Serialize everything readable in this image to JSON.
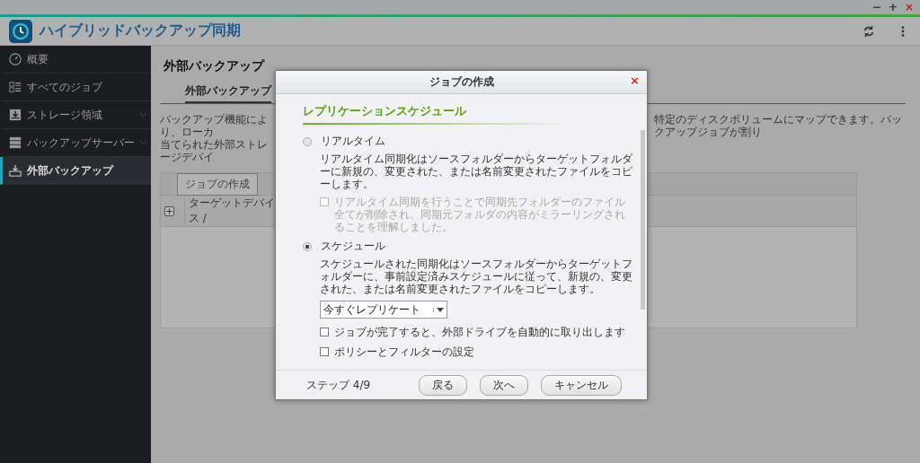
{
  "window_controls": [
    "−",
    "+",
    "×"
  ],
  "app": {
    "title": "ハイブリッドバックアップ同期"
  },
  "sidebar": {
    "items": [
      {
        "label": "概要",
        "expandable": false,
        "selected": false
      },
      {
        "label": "すべてのジョブ",
        "expandable": false,
        "selected": false
      },
      {
        "label": "ストレージ領域",
        "expandable": true,
        "selected": false
      },
      {
        "label": "バックアップサーバー",
        "expandable": true,
        "selected": false
      },
      {
        "label": "外部バックアップ",
        "expandable": false,
        "selected": true
      }
    ]
  },
  "main": {
    "title": "外部バックアップ",
    "tabs": [
      {
        "label": "外部バックアップ",
        "selected": true
      }
    ],
    "description_left": [
      "バックアップ機能により、ローカ",
      "当てられた外部ストレージデバイ"
    ],
    "description_right": "特定のディスクボリュームにマップできます。バックアップジョブが割り",
    "table": {
      "toolbar_button": "ジョブの作成",
      "expand_symbol": "+",
      "column_1": "ターゲットデバイス /"
    }
  },
  "dialog": {
    "title": "ジョブの作成",
    "close": "×",
    "section_title": "レプリケーションスケジュール",
    "options": [
      {
        "label": "リアルタイム",
        "selected": false,
        "description": "リアルタイム同期化はソースフォルダーからターゲットフォルダーに新規の、変更された、または名前変更されたファイルをコピーします。",
        "confirm": {
          "label": "リアルタイム同期を行うことで同期先フォルダーのファイル全てが削除され、同期元フォルダの内容がミラーリングされることを理解しました。",
          "checked": false,
          "disabled": true
        }
      },
      {
        "label": "スケジュール",
        "selected": true,
        "description": "スケジュールされた同期化はソースフォルダーからターゲットフォルダーに、事前設定済みスケジュールに従って、新規の、変更された、または名前変更されたファイルをコピーします。",
        "select": "今すぐレプリケート"
      }
    ],
    "checkboxes": [
      {
        "label": "ジョブが完了すると、外部ドライブを自動的に取り出します",
        "checked": false,
        "disabled": false
      },
      {
        "label": "ポリシーとフィルターの設定",
        "checked": false,
        "disabled": false
      }
    ],
    "step": "ステップ 4/9",
    "buttons": [
      "戻る",
      "次へ",
      "キャンセル"
    ]
  }
}
